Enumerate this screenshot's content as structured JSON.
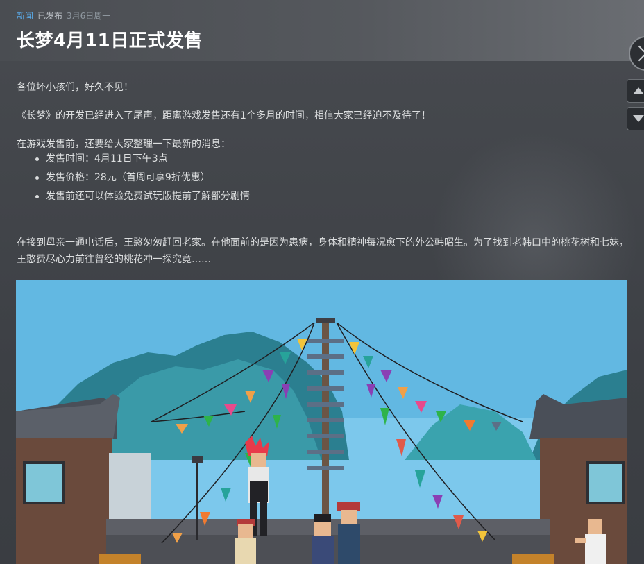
{
  "header": {
    "category": "新闻",
    "status": "已发布",
    "date": "3月6日周一",
    "title": "长梦4月11日正式发售"
  },
  "content": {
    "greeting": "各位坏小孩们，好久不见！",
    "paragraph1": "《长梦》的开发已经进入了尾声，距离游戏发售还有1个多月的时间，相信大家已经迫不及待了！",
    "intro": "在游戏发售前，还要给大家整理一下最新的消息：",
    "bullets": [
      "发售时间：4月11日下午3点",
      "发售价格：28元（首周可享9折优惠）",
      "发售前还可以体验免费试玩版提前了解部分剧情"
    ],
    "story": "在接到母亲一通电话后，王憨匆匆赶回老家。在他面前的是因为患病，身体和精神每况愈下的外公韩昭生。为了找到老韩口中的桃花树和七妹，王憨费尽心力前往曾经的桃花冲一探究竟……"
  },
  "controls": {
    "close_icon": "close-icon",
    "prev_icon": "caret-up-icon",
    "next_icon": "caret-down-icon"
  }
}
